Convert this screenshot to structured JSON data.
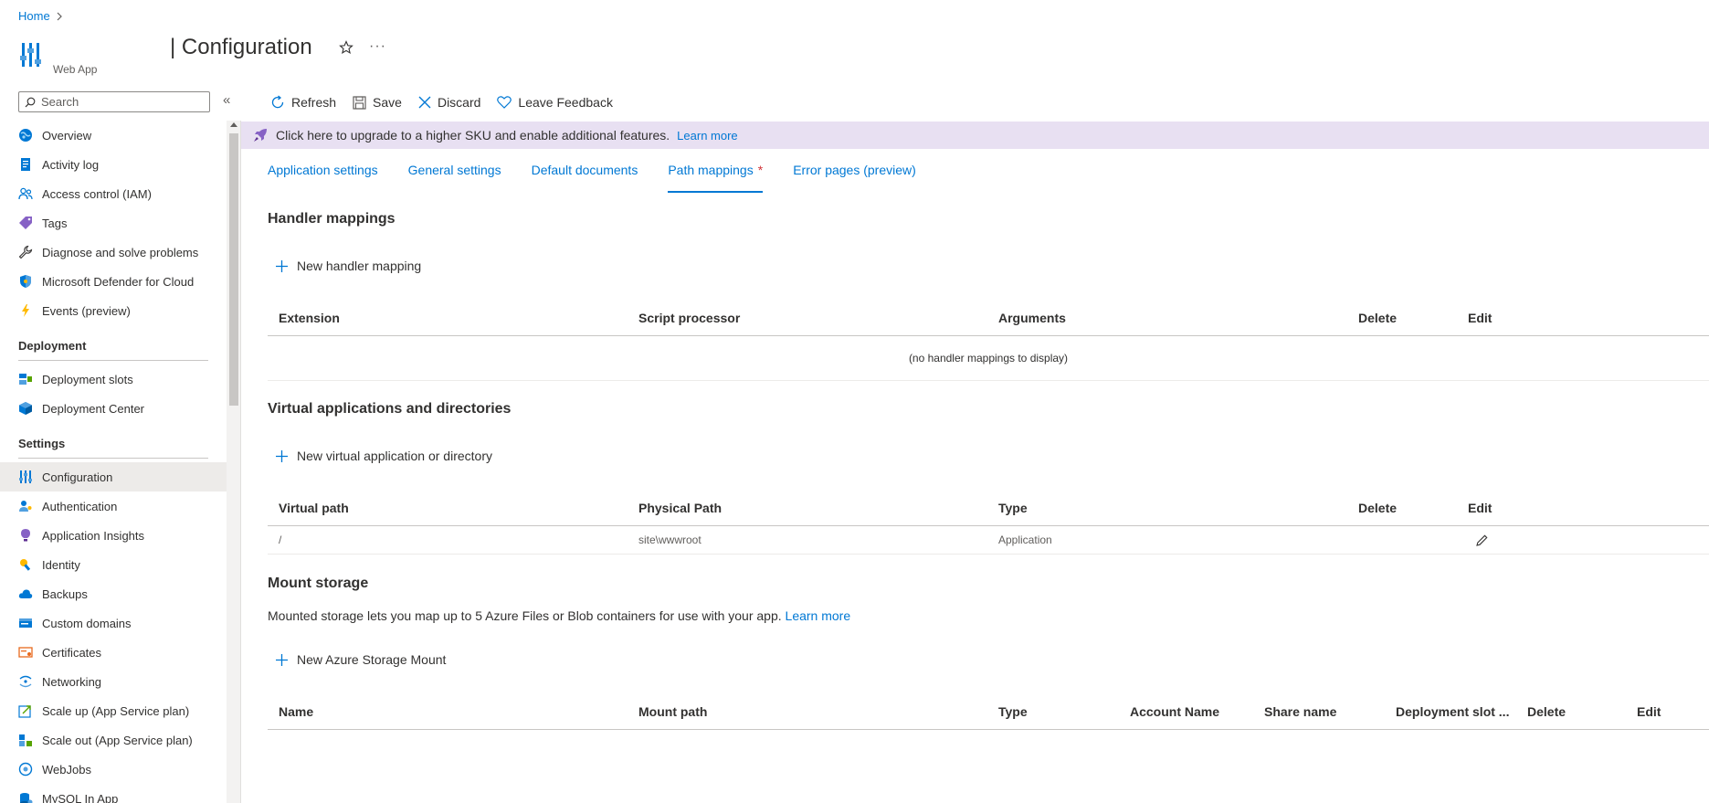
{
  "breadcrumb": {
    "home": "Home"
  },
  "header": {
    "title": "| Configuration",
    "subtitle": "Web App"
  },
  "search": {
    "placeholder": "Search"
  },
  "sidebar": {
    "items_top": [
      {
        "label": "Overview",
        "icon": "globe-icon"
      },
      {
        "label": "Activity log",
        "icon": "log-icon"
      },
      {
        "label": "Access control (IAM)",
        "icon": "people-icon"
      },
      {
        "label": "Tags",
        "icon": "tag-icon"
      },
      {
        "label": "Diagnose and solve problems",
        "icon": "wrench-icon"
      },
      {
        "label": "Microsoft Defender for Cloud",
        "icon": "shield-icon"
      },
      {
        "label": "Events (preview)",
        "icon": "lightning-icon"
      }
    ],
    "deployment_group": "Deployment",
    "deployment_items": [
      {
        "label": "Deployment slots",
        "icon": "slots-icon"
      },
      {
        "label": "Deployment Center",
        "icon": "cube-icon"
      }
    ],
    "settings_group": "Settings",
    "settings_items": [
      {
        "label": "Configuration",
        "icon": "config-icon"
      },
      {
        "label": "Authentication",
        "icon": "person-key-icon"
      },
      {
        "label": "Application Insights",
        "icon": "bulb-icon"
      },
      {
        "label": "Identity",
        "icon": "identity-icon"
      },
      {
        "label": "Backups",
        "icon": "cloud-icon"
      },
      {
        "label": "Custom domains",
        "icon": "domain-icon"
      },
      {
        "label": "Certificates",
        "icon": "certificate-icon"
      },
      {
        "label": "Networking",
        "icon": "network-icon"
      },
      {
        "label": "Scale up (App Service plan)",
        "icon": "scale-up-icon"
      },
      {
        "label": "Scale out (App Service plan)",
        "icon": "scale-out-icon"
      },
      {
        "label": "WebJobs",
        "icon": "webjobs-icon"
      },
      {
        "label": "MySQL In App",
        "icon": "mysql-icon"
      }
    ]
  },
  "toolbar": {
    "refresh": "Refresh",
    "save": "Save",
    "discard": "Discard",
    "feedback": "Leave Feedback"
  },
  "banner": {
    "text": "Click here to upgrade to a higher SKU and enable additional features.",
    "link": "Learn more"
  },
  "tabs": [
    {
      "label": "Application settings"
    },
    {
      "label": "General settings"
    },
    {
      "label": "Default documents"
    },
    {
      "label": "Path mappings",
      "modified": "*"
    },
    {
      "label": "Error pages (preview)"
    }
  ],
  "handler": {
    "title": "Handler mappings",
    "add": "New handler mapping",
    "columns": [
      "Extension",
      "Script processor",
      "Arguments",
      "Delete",
      "Edit"
    ],
    "empty": "(no handler mappings to display)"
  },
  "virtual": {
    "title": "Virtual applications and directories",
    "add": "New virtual application or directory",
    "columns": [
      "Virtual path",
      "Physical Path",
      "Type",
      "Delete",
      "Edit"
    ],
    "rows": [
      {
        "virtual_path": "/",
        "physical_path": "site\\wwwroot",
        "type": "Application"
      }
    ]
  },
  "mount": {
    "title": "Mount storage",
    "description": "Mounted storage lets you map up to 5 Azure Files or Blob containers for use with your app.",
    "link": "Learn more",
    "add": "New Azure Storage Mount",
    "columns": [
      "Name",
      "Mount path",
      "Type",
      "Account Name",
      "Share name",
      "Deployment slot ...",
      "Delete",
      "Edit"
    ]
  },
  "colors": {
    "accent": "#0078d4",
    "banner_bg": "#e8e0f2",
    "modified_marker": "#d13438"
  }
}
